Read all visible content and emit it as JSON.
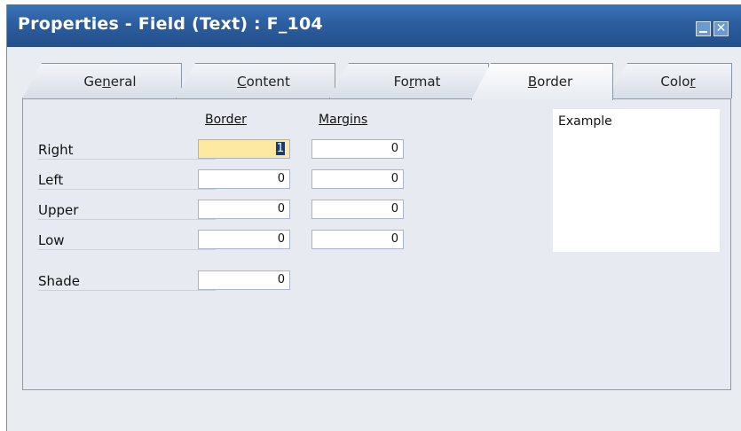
{
  "window": {
    "title": "Properties - Field (Text) : F_104"
  },
  "tabs": [
    {
      "label_pre": "Ge",
      "label_u": "n",
      "label_post": "eral"
    },
    {
      "label_pre": "",
      "label_u": "C",
      "label_post": "ontent"
    },
    {
      "label_pre": "Fo",
      "label_u": "r",
      "label_post": "mat"
    },
    {
      "label_pre": "",
      "label_u": "B",
      "label_post": "order"
    },
    {
      "label_pre": "Colo",
      "label_u": "r",
      "label_post": ""
    }
  ],
  "border_tab": {
    "headers": {
      "border": "Border",
      "margins": "Margins"
    },
    "rows": [
      {
        "label": "Right",
        "border": "1",
        "margin": "0"
      },
      {
        "label": "Left",
        "border": "0",
        "margin": "0"
      },
      {
        "label": "Upper",
        "border": "0",
        "margin": "0"
      },
      {
        "label": "Low",
        "border": "0",
        "margin": "0"
      }
    ],
    "shade": {
      "label": "Shade",
      "value": "0"
    },
    "example_label": "Example"
  }
}
